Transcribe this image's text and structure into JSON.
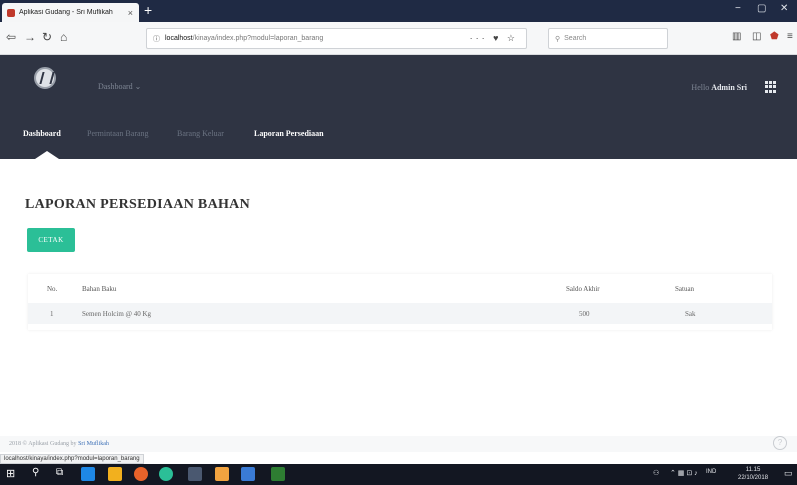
{
  "browser": {
    "tab_title": "Aplikasi Gudang - Sri Muflikah",
    "tab_close": "×",
    "new_tab": "+",
    "window_controls": [
      "−",
      "▢",
      "✕"
    ],
    "url_host": "localhost",
    "url_rest": "/kinaya/index.php?modul=laporan_barang",
    "url_actions": "··· ♥ ☆",
    "search_placeholder": "Search",
    "status_url": "localhost/kinaya/index.php?modul=laporan_barang"
  },
  "header": {
    "dashboard_dropdown": "Dashboard",
    "hello_label": "Hello",
    "username": "Admin Sri",
    "menu": [
      {
        "label": "Dashboard",
        "active": true
      },
      {
        "label": "Permintaan Barang",
        "active": false
      },
      {
        "label": "Barang Keluar",
        "active": false
      },
      {
        "label": "Laporan Persediaan",
        "active": true
      }
    ]
  },
  "main": {
    "page_title": "LAPORAN PERSEDIAAN BAHAN",
    "print_button": "CETAK",
    "table": {
      "headers": [
        "No.",
        "Bahan Baku",
        "Saldo Akhir",
        "Satuan"
      ],
      "rows": [
        [
          "1",
          "Semen Holcim @ 40 Kg",
          "500",
          "Sak"
        ]
      ]
    }
  },
  "footer": {
    "text": "2018 © Aplikasi Gudang by",
    "author": "Sri Muflikah"
  },
  "taskbar": {
    "tray_lang": "IND",
    "time": "11.15",
    "date": "22/10/2018"
  },
  "colors": {
    "accent": "#2bbf97",
    "header_bg": "#2f3443"
  }
}
